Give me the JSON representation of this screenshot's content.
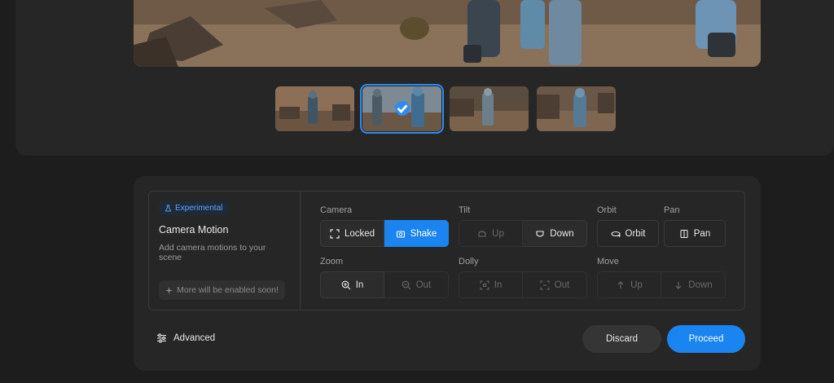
{
  "preview": {
    "thumbnails": [
      {
        "name": "thumb-1",
        "selected": false
      },
      {
        "name": "thumb-2",
        "selected": true
      },
      {
        "name": "thumb-3",
        "selected": false
      },
      {
        "name": "thumb-4",
        "selected": false
      }
    ]
  },
  "camera_motion": {
    "badge": "Experimental",
    "title": "Camera Motion",
    "description": "Add camera motions to your scene",
    "soon": "More will be enabled soon!",
    "groups": {
      "camera": {
        "label": "Camera",
        "locked": "Locked",
        "shake": "Shake"
      },
      "tilt": {
        "label": "Tilt",
        "up": "Up",
        "down": "Down"
      },
      "orbit": {
        "label": "Orbit",
        "orbit": "Orbit"
      },
      "pan": {
        "label": "Pan",
        "pan": "Pan"
      },
      "zoom": {
        "label": "Zoom",
        "in": "In",
        "out": "Out"
      },
      "dolly": {
        "label": "Dolly",
        "in": "In",
        "out": "Out"
      },
      "move": {
        "label": "Move",
        "up": "Up",
        "down": "Down"
      }
    }
  },
  "footer": {
    "advanced": "Advanced",
    "discard": "Discard",
    "proceed": "Proceed"
  },
  "colors": {
    "accent": "#1a84f0",
    "panel": "#262626",
    "background": "#1d1d1d"
  }
}
